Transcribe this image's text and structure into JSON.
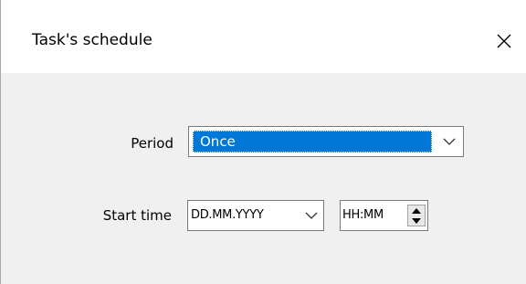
{
  "window": {
    "title": "Task's schedule",
    "close_glyph": "✕"
  },
  "form": {
    "period": {
      "label": "Period",
      "value": "Once",
      "icon": "chevron-down-icon"
    },
    "start_time": {
      "label": "Start time",
      "date_value": "DD.MM.YYYY",
      "date_icon": "chevron-down-icon",
      "time_value": "HH:MM",
      "time_icons": [
        "spin-up-icon",
        "spin-down-icon"
      ]
    }
  },
  "colors": {
    "selection": "#0078d7",
    "client_bg": "#f0f0f0",
    "border": "#7a7a7a"
  }
}
